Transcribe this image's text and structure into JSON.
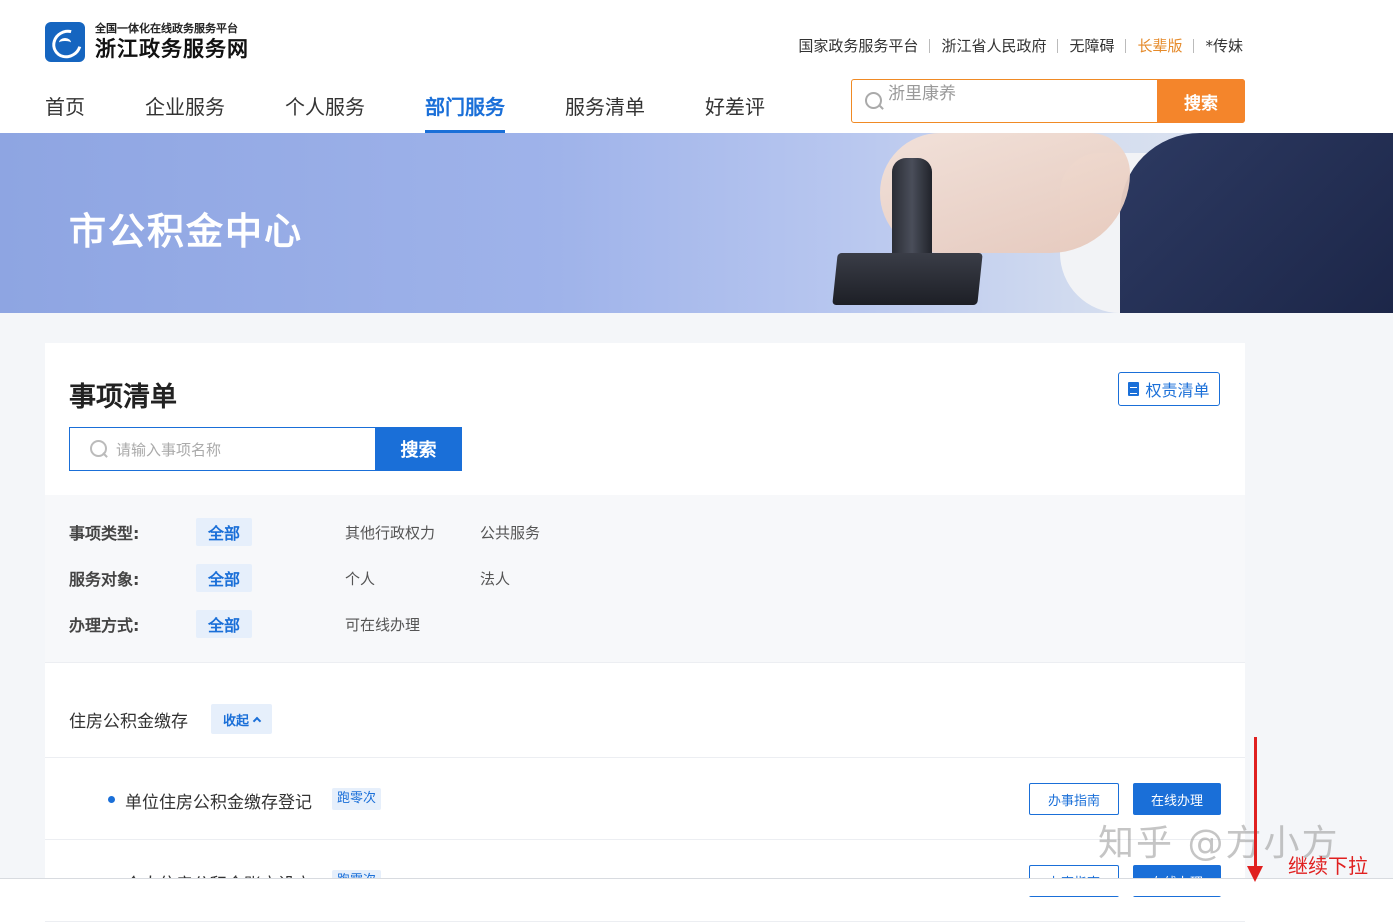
{
  "brand": {
    "subtitle": "全国一体化在线政务服务平台",
    "name": "浙江政务服务网"
  },
  "toplinks": [
    {
      "label": "国家政务服务平台"
    },
    {
      "label": "浙江省人民政府"
    },
    {
      "label": "无障碍"
    },
    {
      "label": "长辈版"
    },
    {
      "label": "*传妹"
    }
  ],
  "nav": [
    {
      "label": "首页"
    },
    {
      "label": "企业服务"
    },
    {
      "label": "个人服务"
    },
    {
      "label": "部门服务"
    },
    {
      "label": "服务清单"
    },
    {
      "label": "好差评"
    }
  ],
  "top_search": {
    "value": "浙里康养",
    "button": "搜索"
  },
  "banner": {
    "title": "市公积金中心"
  },
  "section": {
    "title": "事项清单",
    "duty_button": "权责清单",
    "search_placeholder": "请输入事项名称",
    "search_button": "搜索"
  },
  "filters": [
    {
      "label": "事项类型:",
      "selected": "全部",
      "options": [
        "其他行政权力",
        "公共服务"
      ]
    },
    {
      "label": "服务对象:",
      "selected": "全部",
      "options": [
        "个人",
        "法人"
      ]
    },
    {
      "label": "办理方式:",
      "selected": "全部",
      "options": [
        "可在线办理"
      ]
    }
  ],
  "group": {
    "title": "住房公积金缴存",
    "collapse": "收起"
  },
  "services": [
    {
      "name": "单位住房公积金缴存登记",
      "tag": "跑零次",
      "guide": "办事指南",
      "online": "在线办理"
    },
    {
      "name": "个人住房公积金账户设立",
      "tag": "跑零次",
      "guide": "办事指南",
      "online": "在线办理"
    }
  ],
  "overlay": {
    "watermark": "知乎 @方小方",
    "note": "继续下拉"
  }
}
